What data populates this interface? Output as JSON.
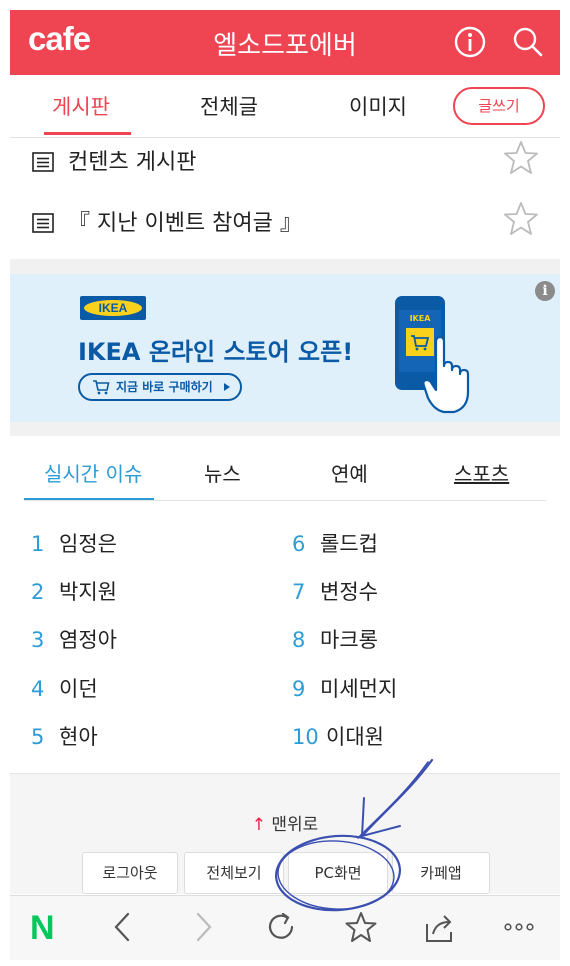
{
  "header": {
    "logo": "cafe",
    "title": "엘소드포에버",
    "info_icon": "info-icon",
    "search_icon": "search-icon"
  },
  "tabs": {
    "items": [
      "게시판",
      "전체글",
      "이미지"
    ],
    "active": 0,
    "write_label": "글쓰기"
  },
  "boards": [
    {
      "label": "컨텐츠 게시판"
    },
    {
      "label": "『 지난 이벤트 참여글 』"
    }
  ],
  "ad": {
    "badge": "i",
    "brand": "IKEA",
    "headline": "IKEA 온라인 스토어 오픈!",
    "cta": "지금 바로 구매하기",
    "phone_brand": "IKEA"
  },
  "issues": {
    "tabs": [
      "실시간 이슈",
      "뉴스",
      "연예",
      "스포츠"
    ],
    "active": 0,
    "left": [
      {
        "num": "1",
        "text": "임정은"
      },
      {
        "num": "2",
        "text": "박지원"
      },
      {
        "num": "3",
        "text": "염정아"
      },
      {
        "num": "4",
        "text": "이던"
      },
      {
        "num": "5",
        "text": "현아"
      }
    ],
    "right": [
      {
        "num": "6",
        "text": "롤드컵"
      },
      {
        "num": "7",
        "text": "변정수"
      },
      {
        "num": "8",
        "text": "마크롱"
      },
      {
        "num": "9",
        "text": "미세먼지"
      },
      {
        "num": "10",
        "text": "이대원"
      }
    ]
  },
  "footer": {
    "to_top": "맨위로",
    "buttons": [
      "로그아웃",
      "전체보기",
      "PC화면",
      "카페앱"
    ]
  },
  "toolbar": {
    "logo": "N"
  },
  "colors": {
    "brand": "#ef4452",
    "accent_blue": "#2e9cd6",
    "ikea_blue": "#0b5aa6",
    "ikea_yellow": "#f8d11c",
    "annotation": "#3a4fb0"
  }
}
